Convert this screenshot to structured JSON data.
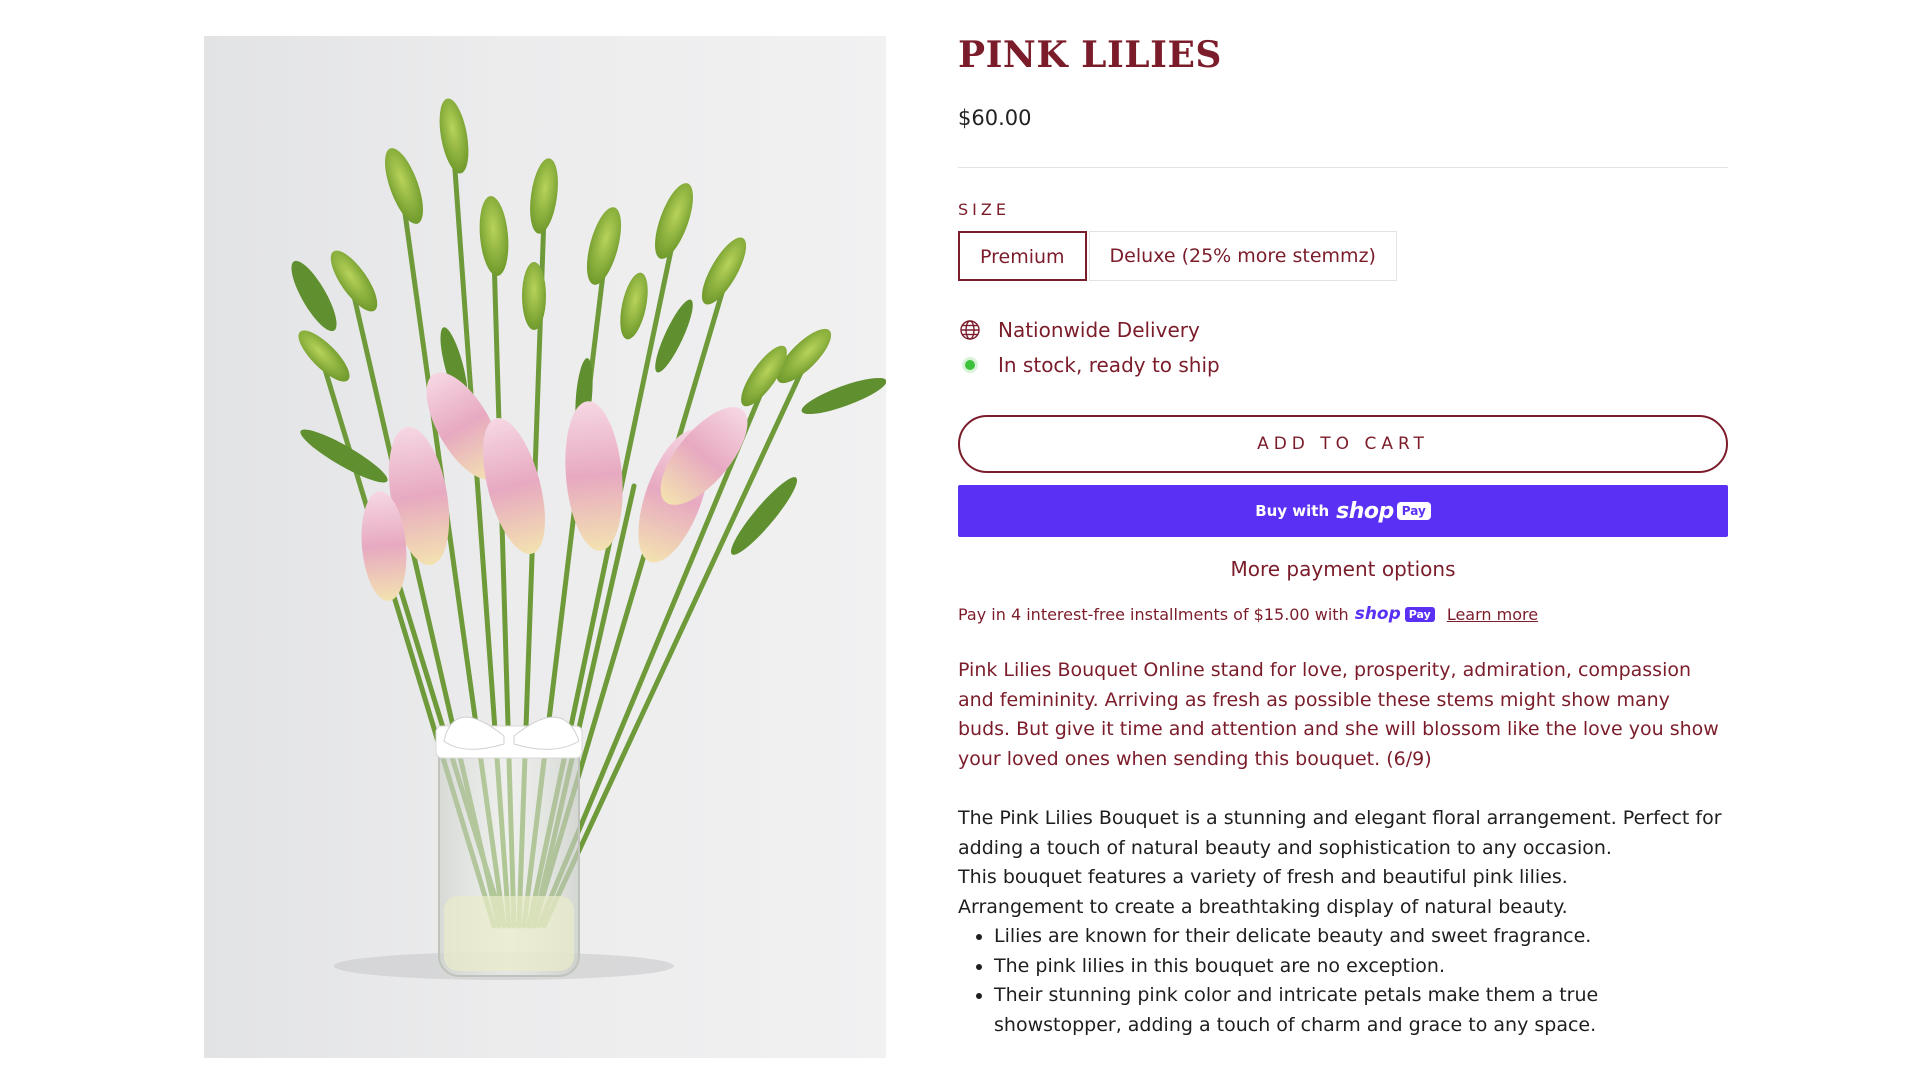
{
  "product": {
    "title": "PINK LILIES",
    "price": "$60.00"
  },
  "size": {
    "label": "SIZE",
    "options": [
      "Premium",
      "Deluxe (25% more stemmz)"
    ],
    "selected": "Premium"
  },
  "info": {
    "delivery": "Nationwide Delivery",
    "stock": "In stock, ready to ship"
  },
  "buttons": {
    "add_to_cart": "ADD TO CART",
    "shop_pay_prefix": "Buy with",
    "shop_pay_brand": "shop",
    "shop_pay_badge": "Pay",
    "more_payment": "More payment options"
  },
  "installments": {
    "text": "Pay in 4 interest-free installments of $15.00 with",
    "brand": "shop",
    "badge": "Pay",
    "learn_more": "Learn more"
  },
  "description": {
    "intro": "Pink Lilies Bouquet Online stand for love, prosperity, admiration, compassion and femininity. Arriving as fresh as possible these stems might show many buds. But give it time and attention and she will blossom like the love you show your loved ones when sending this bouquet. (6/9)",
    "para1": "The Pink Lilies Bouquet is a stunning and elegant floral arrangement. Perfect for adding a touch of natural beauty and sophistication to any occasion.",
    "para2": "This bouquet features a variety of fresh and beautiful pink lilies.",
    "para3": "Arrangement to create a breathtaking display of natural beauty.",
    "bullets": [
      "Lilies are known for their delicate beauty and sweet fragrance.",
      "The pink lilies in this bouquet are no exception.",
      "Their stunning pink color and intricate petals make them a true showstopper, adding a touch of charm and grace to any space."
    ]
  },
  "colors": {
    "brand": "#7b1c2a",
    "shop_pay": "#5a31f4",
    "stock_dot": "#3cc13b"
  }
}
